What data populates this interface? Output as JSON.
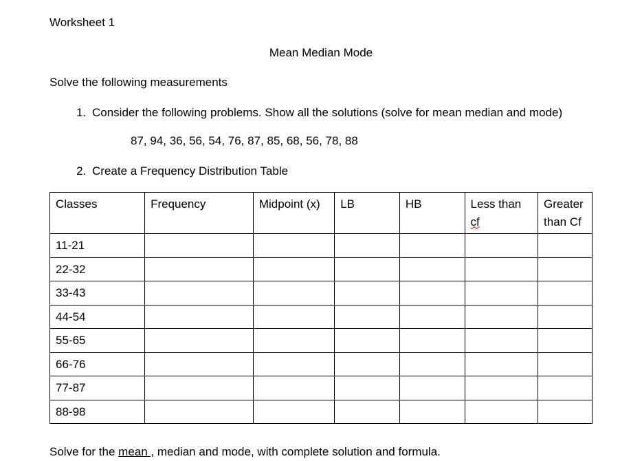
{
  "worksheet_label": "Worksheet 1",
  "main_title": "Mean Median Mode",
  "solve_instruction": "Solve the following measurements",
  "problems": {
    "p1": "Consider the following problems. Show all the solutions (solve for mean median and mode)",
    "p1_data": "87, 94, 36, 56, 54, 76, 87, 85, 68, 56, 78, 88",
    "p2": "Create a Frequency Distribution Table"
  },
  "table": {
    "headers": {
      "classes": "Classes",
      "frequency": "Frequency",
      "midpoint": "Midpoint (x)",
      "lb": "LB",
      "hb": "HB",
      "less_pre": "Less than ",
      "less_cf": "cf",
      "greater": "Greater than Cf"
    },
    "rows": [
      {
        "class": "11-21"
      },
      {
        "class": "22-32"
      },
      {
        "class": "33-43"
      },
      {
        "class": "44-54"
      },
      {
        "class": "55-65"
      },
      {
        "class": "66-76"
      },
      {
        "class": "77-87"
      },
      {
        "class": "88-98"
      }
    ]
  },
  "final": {
    "pre": "Solve for the ",
    "mean": "mean ,",
    "post": " median and mode, with complete solution and formula."
  }
}
